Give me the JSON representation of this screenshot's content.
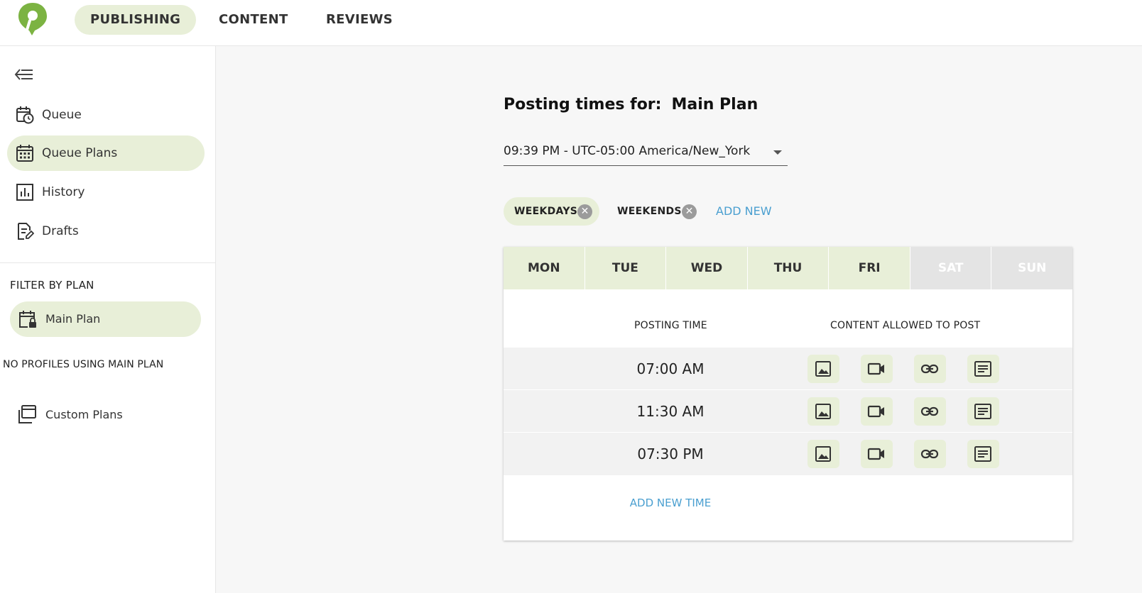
{
  "topnav": {
    "logo_icon": "location-pin-logo",
    "items": [
      {
        "label": "PUBLISHING",
        "active": true
      },
      {
        "label": "CONTENT",
        "active": false
      },
      {
        "label": "REVIEWS",
        "active": false
      }
    ]
  },
  "sidebar": {
    "collapse_icon": "collapse-menu-icon",
    "items": [
      {
        "label": "Queue",
        "icon": "calendar-clock-icon",
        "active": false
      },
      {
        "label": "Queue Plans",
        "icon": "calendar-grid-icon",
        "active": true
      },
      {
        "label": "History",
        "icon": "bar-chart-icon",
        "active": false
      },
      {
        "label": "Drafts",
        "icon": "document-edit-icon",
        "active": false
      }
    ],
    "filter_label": "FILTER BY PLAN",
    "plan": {
      "label": "Main Plan",
      "icon": "calendar-lock-icon"
    },
    "no_profiles": "NO PROFILES USING MAIN PLAN",
    "custom_plans": {
      "label": "Custom Plans",
      "icon": "stacked-calendars-icon"
    }
  },
  "main": {
    "heading_prefix": "Posting times for:",
    "heading_plan": "Main Plan",
    "timezone": "09:39 PM - UTC-05:00 America/New_York",
    "chips": [
      {
        "label": "WEEKDAYS",
        "active": true
      },
      {
        "label": "WEEKENDS",
        "active": false
      }
    ],
    "add_new": "ADD NEW",
    "days": [
      {
        "label": "MON",
        "enabled": true
      },
      {
        "label": "TUE",
        "enabled": true
      },
      {
        "label": "WED",
        "enabled": true
      },
      {
        "label": "THU",
        "enabled": true
      },
      {
        "label": "FRI",
        "enabled": true
      },
      {
        "label": "SAT",
        "enabled": false
      },
      {
        "label": "SUN",
        "enabled": false
      }
    ],
    "col_posting_time": "POSTING TIME",
    "col_content_allowed": "CONTENT ALLOWED TO POST",
    "times": [
      "07:00 AM",
      "11:30 AM",
      "07:30 PM"
    ],
    "content_types": [
      "image-icon",
      "video-icon",
      "link-icon",
      "text-icon"
    ],
    "add_new_time": "ADD NEW TIME"
  },
  "colors": {
    "accent_light": "#e8efd8",
    "brand_green": "#7cb342",
    "link_blue": "#4a9fd0"
  }
}
